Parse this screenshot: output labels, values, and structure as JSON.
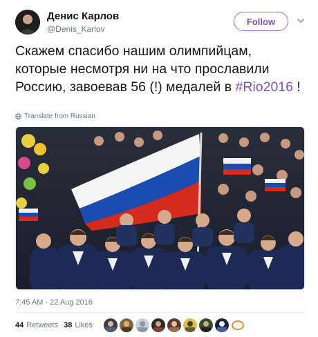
{
  "user": {
    "display_name": "Денис Карлов",
    "handle": "@Denis_Karlov"
  },
  "follow_button": {
    "label": "Follow",
    "color": "#7b4fc4"
  },
  "tweet": {
    "text_main": "Скажем спасибо нашим олимпийцам, которые несмотря ни на что прославили Россию, завоевав 56 (!) медалей в ",
    "hashtag": "#Rio2016",
    "text_end": " !"
  },
  "translate_label": "Translate from Russian",
  "timestamp": "7:45 AM - 22 Aug 2016",
  "stats": {
    "retweets_count": "44",
    "retweets_label": "Retweets",
    "likes_count": "38",
    "likes_label": "Likes"
  },
  "likers": [
    "avatar-1",
    "avatar-2",
    "avatar-3",
    "avatar-4",
    "avatar-5",
    "avatar-6",
    "avatar-7",
    "avatar-8",
    "avatar-9"
  ],
  "colors": {
    "text": "#14171a",
    "secondary": "#657786",
    "accent": "#7b4fc4",
    "flag_white": "#f4f4f4",
    "flag_blue": "#1b4db0",
    "flag_red": "#d52b1e"
  }
}
